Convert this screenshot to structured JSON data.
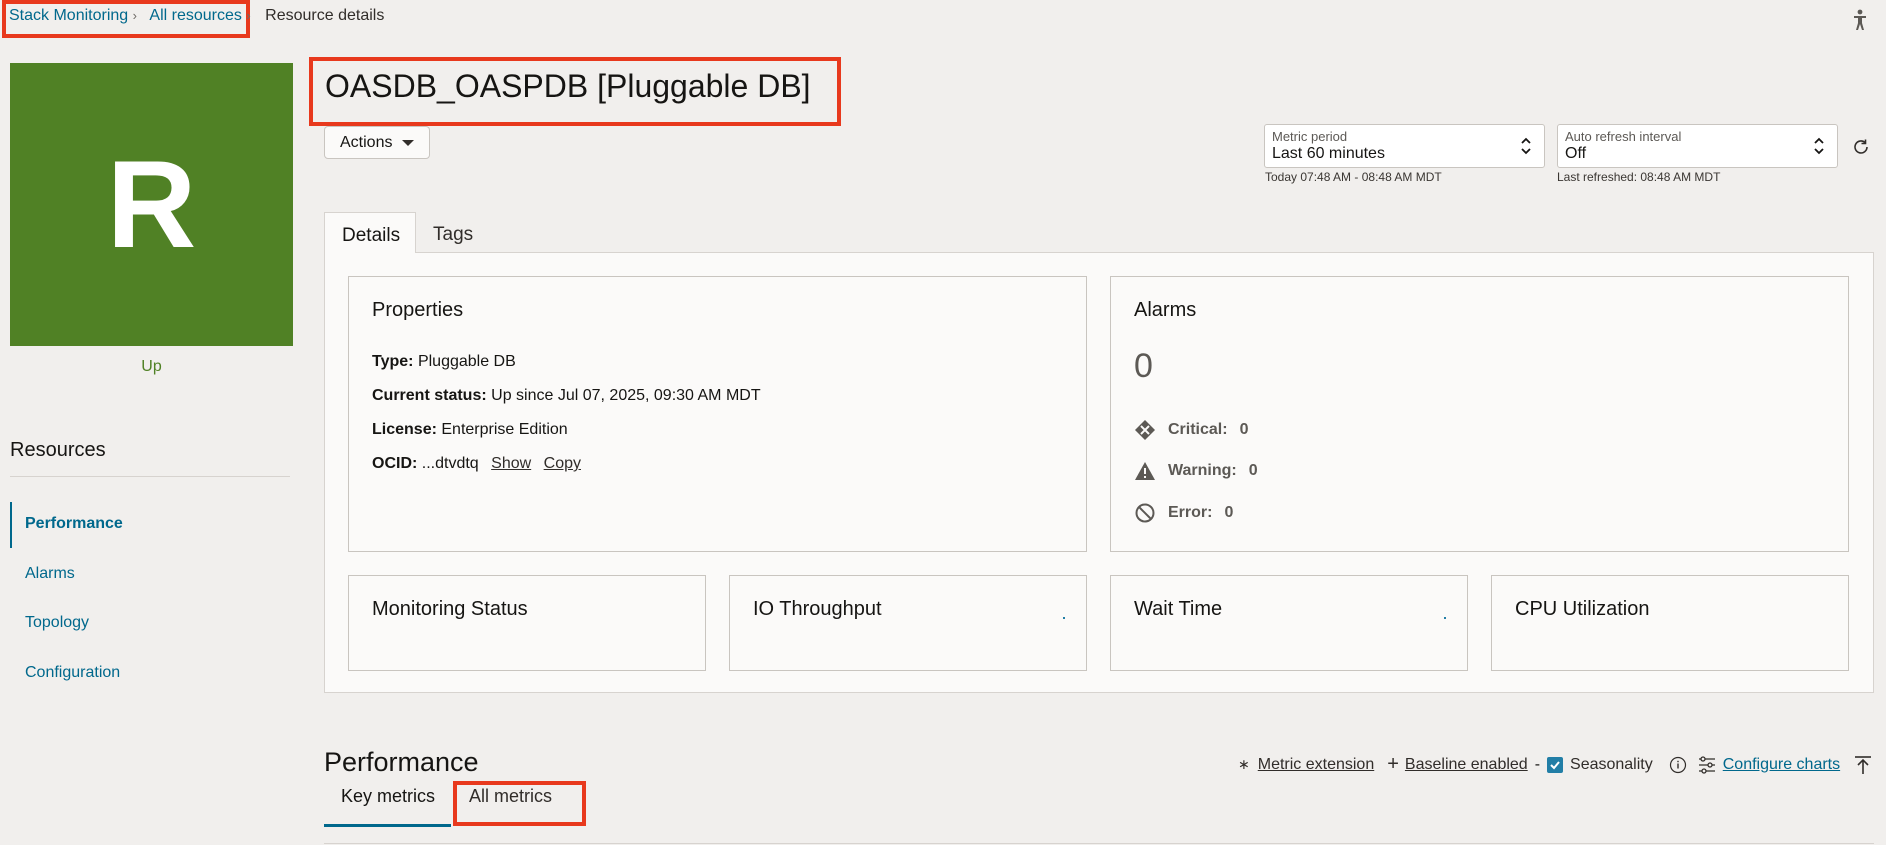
{
  "breadcrumb": {
    "items": [
      {
        "label": "Stack Monitoring"
      },
      {
        "label": "All resources"
      },
      {
        "label": "Resource details"
      }
    ],
    "separator": "›"
  },
  "resource": {
    "avatar_letter": "R",
    "avatar_color": "#508125",
    "status": "Up",
    "title": "OASDB_OASPDB [Pluggable DB]"
  },
  "actions": {
    "label": "Actions"
  },
  "metric_period": {
    "label": "Metric period",
    "value": "Last 60 minutes",
    "note": "Today 07:48 AM - 08:48 AM MDT"
  },
  "auto_refresh": {
    "label": "Auto refresh interval",
    "value": "Off",
    "note": "Last refreshed: 08:48 AM MDT"
  },
  "sidebar": {
    "title": "Resources",
    "items": [
      {
        "label": "Performance",
        "active": true
      },
      {
        "label": "Alarms"
      },
      {
        "label": "Topology"
      },
      {
        "label": "Configuration"
      }
    ]
  },
  "tabs": [
    {
      "label": "Details",
      "active": true
    },
    {
      "label": "Tags"
    }
  ],
  "properties": {
    "title": "Properties",
    "rows": [
      {
        "key": "Type:",
        "value": "Pluggable DB"
      },
      {
        "key": "Current status:",
        "value": "Up since Jul 07, 2025, 09:30 AM MDT"
      },
      {
        "key": "License:",
        "value": "Enterprise Edition"
      },
      {
        "key": "OCID:",
        "value": "...dtvdtq"
      }
    ],
    "show_label": "Show",
    "copy_label": "Copy"
  },
  "alarms": {
    "title": "Alarms",
    "total": "0",
    "critical_label": "Critical:",
    "critical": "0",
    "warning_label": "Warning:",
    "warning": "0",
    "error_label": "Error:",
    "error": "0"
  },
  "metric_cards": [
    {
      "title": "Monitoring Status"
    },
    {
      "title": "IO Throughput"
    },
    {
      "title": "Wait Time"
    },
    {
      "title": "CPU Utilization"
    }
  ],
  "performance": {
    "title": "Performance",
    "metric_extension": "Metric extension",
    "baseline": "Baseline enabled",
    "dash": "-",
    "seasonality": "Seasonality",
    "seasonality_checked": true,
    "configure": "Configure charts",
    "tabs": [
      {
        "label": "Key metrics",
        "active": true
      },
      {
        "label": "All metrics"
      }
    ]
  },
  "colors": {
    "accent": "#00688c",
    "highlight": "#e8391d",
    "up": "#508125"
  }
}
